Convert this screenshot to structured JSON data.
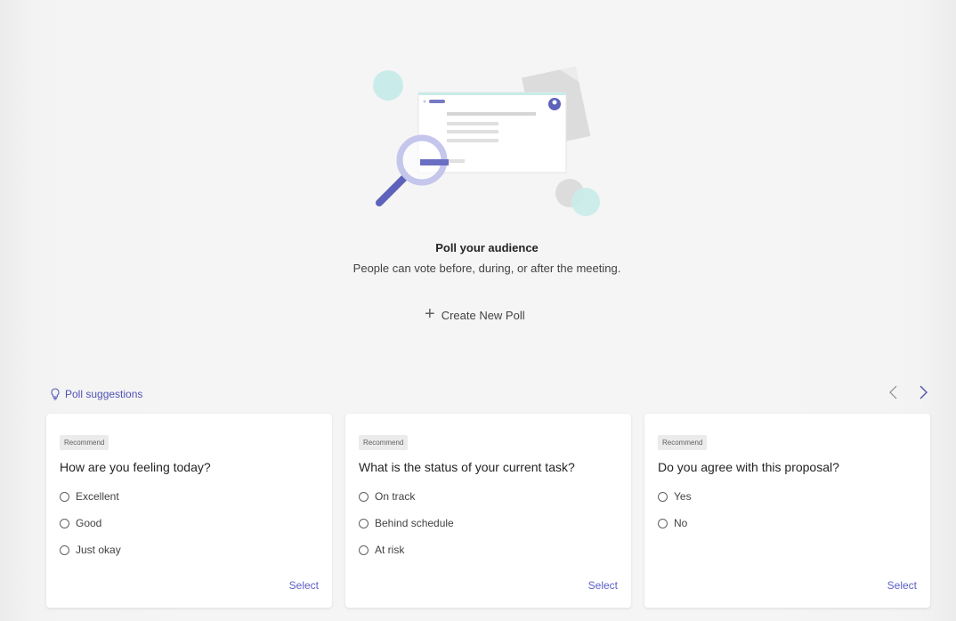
{
  "hero": {
    "title": "Poll your audience",
    "subtitle": "People can vote before, during, or after the  meeting.",
    "create_label": "Create New Poll"
  },
  "suggestions": {
    "header": "Poll suggestions",
    "cards": [
      {
        "badge": "Recommend",
        "question": "How are you feeling today?",
        "options": [
          "Excellent",
          "Good",
          "Just okay"
        ],
        "select_label": "Select"
      },
      {
        "badge": "Recommend",
        "question": "What is the status of your current task?",
        "options": [
          "On track",
          "Behind schedule",
          "At risk"
        ],
        "select_label": "Select"
      },
      {
        "badge": "Recommend",
        "question": "Do you agree with this proposal?",
        "options": [
          "Yes",
          "No"
        ],
        "select_label": "Select"
      }
    ]
  },
  "icons": {
    "create": "plus-icon",
    "suggestions": "lightbulb-icon",
    "prev": "chevron-left-icon",
    "next": "chevron-right-icon"
  },
  "colors": {
    "accent": "#5b5fc7",
    "accent_dark": "#4f52b2",
    "teal": "#c9ecea",
    "lavender": "#c5c6ec"
  }
}
